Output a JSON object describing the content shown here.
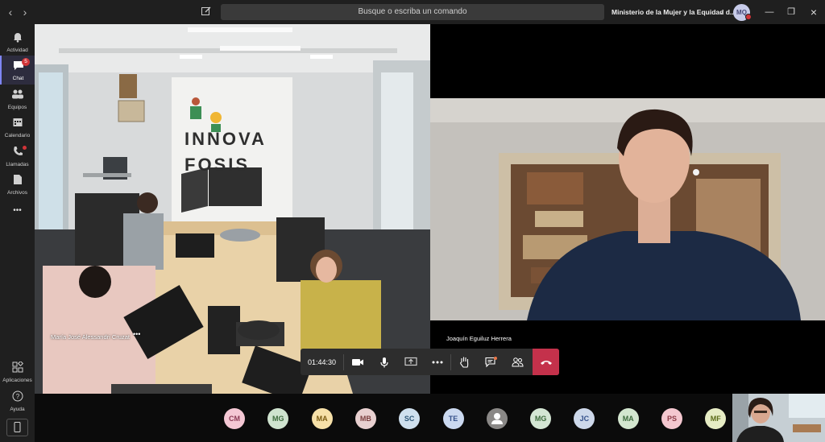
{
  "titlebar": {
    "search_placeholder": "Busque o escriba un comando",
    "org_name": "Ministerio de la Mujer y la Equidad d...",
    "user_initials": "MQ"
  },
  "rail": {
    "items": [
      {
        "label": "Actividad",
        "icon": "bell-icon"
      },
      {
        "label": "Chat",
        "icon": "chat-icon",
        "badge": "5"
      },
      {
        "label": "Equipos",
        "icon": "teams-icon"
      },
      {
        "label": "Calendario",
        "icon": "calendar-icon"
      },
      {
        "label": "Llamadas",
        "icon": "phone-icon"
      },
      {
        "label": "Archivos",
        "icon": "file-icon"
      }
    ],
    "more": "•••",
    "bottom": [
      {
        "label": "Aplicaciones",
        "icon": "apps-icon"
      },
      {
        "label": "Ayuda",
        "icon": "help-icon"
      }
    ]
  },
  "call": {
    "left_participant": "María José Alessandri Cruzat",
    "right_participant": "Joaquín Eguiluz Herrera",
    "timer": "01:44:30",
    "more_label": "•••",
    "room_banner": {
      "l1": "INNOVA",
      "l2": "FOSIS"
    }
  },
  "participants": [
    {
      "initials": "CM",
      "bg": "#f4c7d4",
      "fg": "#8b3a55"
    },
    {
      "initials": "MG",
      "bg": "#cfe3cf",
      "fg": "#3d6b3d"
    },
    {
      "initials": "MA",
      "bg": "#f6e0a8",
      "fg": "#7a5a10"
    },
    {
      "initials": "MB",
      "bg": "#e8d0d0",
      "fg": "#7a3f3f"
    },
    {
      "initials": "SC",
      "bg": "#cfe0ee",
      "fg": "#2f5878"
    },
    {
      "initials": "TE",
      "bg": "#cbd9f0",
      "fg": "#34508a"
    },
    {
      "initials": "",
      "bg": "#8a8886",
      "fg": "#ffffff"
    },
    {
      "initials": "MG",
      "bg": "#d4e6d4",
      "fg": "#3d6b3d"
    },
    {
      "initials": "JC",
      "bg": "#cdd8ea",
      "fg": "#34508a"
    },
    {
      "initials": "MA",
      "bg": "#d3e6cf",
      "fg": "#3d6b3d"
    },
    {
      "initials": "PS",
      "bg": "#f4c7cf",
      "fg": "#8b3a45"
    },
    {
      "initials": "MF",
      "bg": "#e6ecc4",
      "fg": "#5c6b1a"
    }
  ],
  "colors": {
    "accent": "#7f85f5",
    "end_call": "#c4314b",
    "badge": "#d13438"
  }
}
